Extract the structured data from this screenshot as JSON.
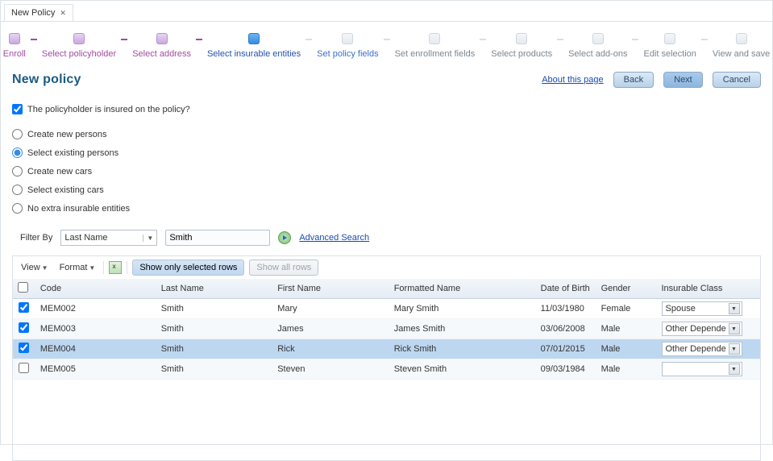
{
  "tab": {
    "title": "New Policy"
  },
  "train": [
    {
      "label": "Enroll",
      "state": "complete"
    },
    {
      "label": "Select policyholder",
      "state": "complete"
    },
    {
      "label": "Select address",
      "state": "complete"
    },
    {
      "label": "Select insurable entities",
      "state": "current"
    },
    {
      "label": "Set policy fields",
      "state": "next"
    },
    {
      "label": "Set enrollment fields",
      "state": "pending"
    },
    {
      "label": "Select products",
      "state": "pending"
    },
    {
      "label": "Select add-ons",
      "state": "pending"
    },
    {
      "label": "Edit selection",
      "state": "pending"
    },
    {
      "label": "View and save",
      "state": "pending"
    }
  ],
  "page_title": "New policy",
  "about_link": "About this page",
  "buttons": {
    "back": "Back",
    "next": "Next",
    "cancel": "Cancel"
  },
  "checkbox_label": "The policyholder is insured on the policy?",
  "checkbox_checked": true,
  "radio_options": [
    {
      "label": "Create new persons",
      "checked": false
    },
    {
      "label": "Select existing persons",
      "checked": true
    },
    {
      "label": "Create new cars",
      "checked": false
    },
    {
      "label": "Select existing cars",
      "checked": false
    },
    {
      "label": "No extra insurable entities",
      "checked": false
    }
  ],
  "filter": {
    "label": "Filter By",
    "field": "Last Name",
    "value": "Smith",
    "advanced": "Advanced Search"
  },
  "toolbar": {
    "view": "View",
    "format": "Format",
    "show_selected": "Show only selected rows",
    "show_all": "Show all rows"
  },
  "columns": {
    "code": "Code",
    "last": "Last Name",
    "first": "First Name",
    "formatted": "Formatted Name",
    "dob": "Date of Birth",
    "gender": "Gender",
    "class": "Insurable Class"
  },
  "rows": [
    {
      "checked": true,
      "code": "MEM002",
      "last": "Smith",
      "first": "Mary",
      "formatted": "Mary Smith",
      "dob": "11/03/1980",
      "gender": "Female",
      "class": "Spouse",
      "selected": false
    },
    {
      "checked": true,
      "code": "MEM003",
      "last": "Smith",
      "first": "James",
      "formatted": "James Smith",
      "dob": "03/06/2008",
      "gender": "Male",
      "class": "Other Depende",
      "selected": false
    },
    {
      "checked": true,
      "code": "MEM004",
      "last": "Smith",
      "first": "Rick",
      "formatted": "Rick Smith",
      "dob": "07/01/2015",
      "gender": "Male",
      "class": "Other Depende",
      "selected": true
    },
    {
      "checked": false,
      "code": "MEM005",
      "last": "Smith",
      "first": "Steven",
      "formatted": "Steven Smith",
      "dob": "09/03/1984",
      "gender": "Male",
      "class": "",
      "selected": false
    }
  ]
}
